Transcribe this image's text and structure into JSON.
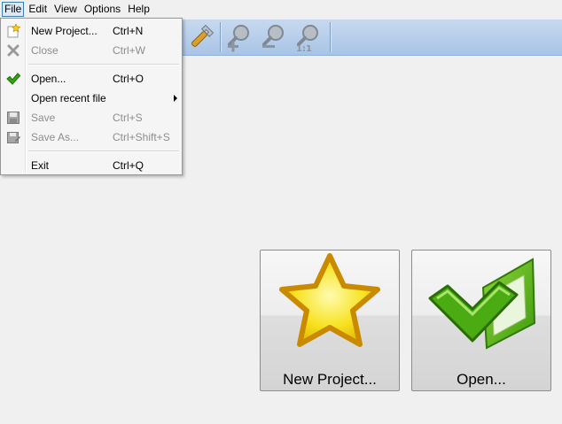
{
  "menubar": {
    "items": [
      {
        "label": "File"
      },
      {
        "label": "Edit"
      },
      {
        "label": "View"
      },
      {
        "label": "Options"
      },
      {
        "label": "Help"
      }
    ]
  },
  "file_menu": {
    "new_project": {
      "label": "New Project...",
      "shortcut": "Ctrl+N",
      "icon": "new-star-icon",
      "enabled": true
    },
    "close": {
      "label": "Close",
      "shortcut": "Ctrl+W",
      "icon": "close-x-icon",
      "enabled": false
    },
    "open": {
      "label": "Open...",
      "shortcut": "Ctrl+O",
      "icon": "green-check-icon",
      "enabled": true
    },
    "open_recent": {
      "label": "Open recent file",
      "has_submenu": true,
      "enabled": true
    },
    "save": {
      "label": "Save",
      "shortcut": "Ctrl+S",
      "icon": "floppy-disk-icon",
      "enabled": false
    },
    "save_as": {
      "label": "Save As...",
      "shortcut": "Ctrl+Shift+S",
      "icon": "floppy-disk-edit-icon",
      "enabled": false
    },
    "exit": {
      "label": "Exit",
      "shortcut": "Ctrl+Q",
      "enabled": true
    }
  },
  "toolbar": {
    "buttons": [
      {
        "icon": "wrench-icon",
        "enabled": true
      },
      {
        "icon": "zoom-in-icon",
        "enabled": false
      },
      {
        "icon": "zoom-out-icon",
        "enabled": false
      },
      {
        "icon": "zoom-actual-size-icon",
        "enabled": false
      }
    ]
  },
  "main": {
    "new_project_button": {
      "label": "New Project...",
      "icon": "star-icon"
    },
    "open_button": {
      "label": "Open...",
      "icon": "green-check-folder-icon"
    }
  },
  "colors": {
    "toolbar_top": "#c7d9ef",
    "toolbar_bottom": "#a9c4e6",
    "menu_highlight": "#dbe9f6",
    "menu_highlight_border": "#3c7fb1",
    "disabled_text": "#8d8d8d"
  }
}
